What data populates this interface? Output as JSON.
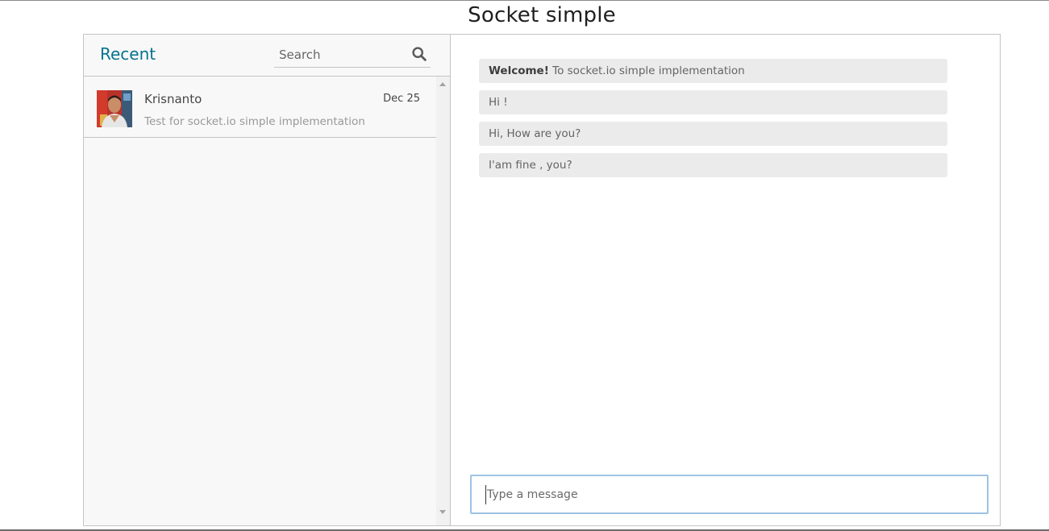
{
  "page": {
    "title": "Socket simple"
  },
  "inbox": {
    "heading": "Recent",
    "search": {
      "placeholder": "Search",
      "value": "",
      "icon": "search-icon"
    },
    "chats": [
      {
        "name": "Krisnanto",
        "date": "Dec 25",
        "preview": "Test for socket.io simple implementation",
        "avatar": "user-photo"
      }
    ]
  },
  "conversation": {
    "messages": [
      {
        "bold": "Welcome!",
        "text": " To socket.io simple implementation"
      },
      {
        "bold": "",
        "text": "Hi !"
      },
      {
        "bold": "",
        "text": "Hi, How are you?"
      },
      {
        "bold": "",
        "text": "I'am fine , you?"
      }
    ],
    "input": {
      "placeholder": "Type a message",
      "value": ""
    }
  },
  "colors": {
    "accent": "#05728f",
    "panel_bg": "#f8f8f8",
    "bubble_bg": "#ebebeb",
    "input_border": "#9ec3e3"
  }
}
